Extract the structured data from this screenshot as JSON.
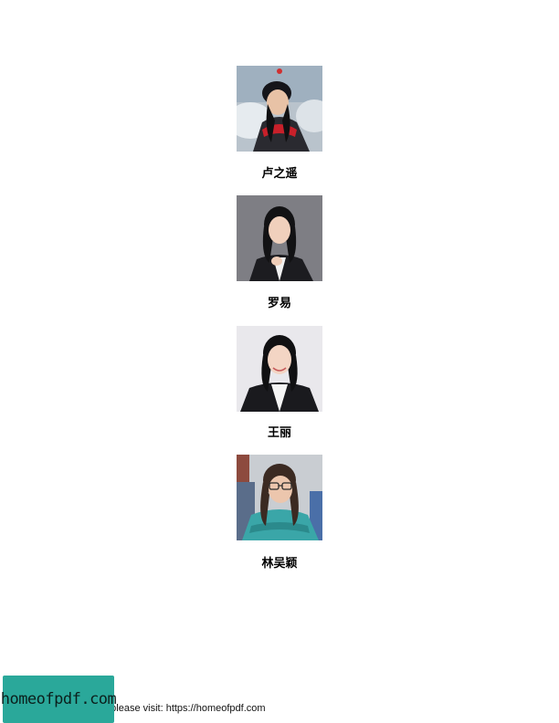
{
  "people": [
    {
      "name": "卢之遥"
    },
    {
      "name": "罗易"
    },
    {
      "name": "王丽"
    },
    {
      "name": "林吴颖"
    }
  ],
  "footer": {
    "text": "e please visit: https://homeofpdf.com"
  },
  "watermark": {
    "text": "homeofpdf.com",
    "color": "#2aa89a"
  }
}
